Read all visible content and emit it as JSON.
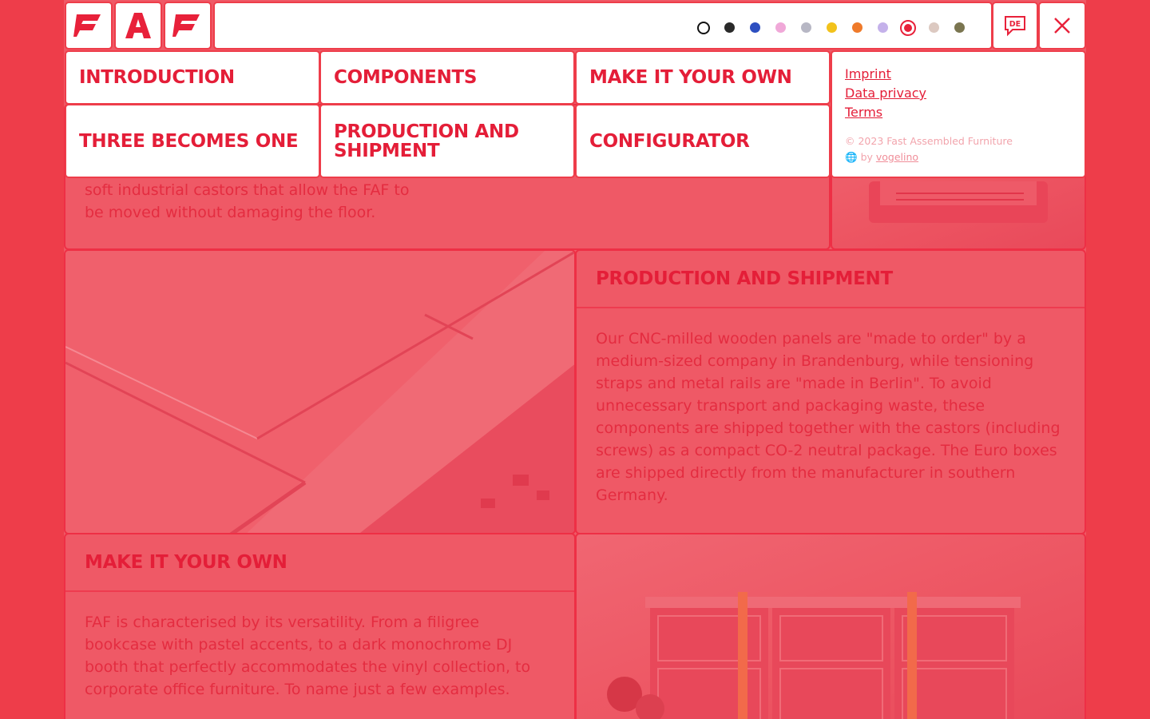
{
  "header": {
    "logo_letters": [
      "F",
      "A",
      "F"
    ],
    "swatches": [
      {
        "name": "white",
        "color": "#ffffff"
      },
      {
        "name": "black",
        "color": "#2a2a2a"
      },
      {
        "name": "blue",
        "color": "#2d4fc0"
      },
      {
        "name": "pink",
        "color": "#f0a8d8"
      },
      {
        "name": "grey",
        "color": "#b7b7c4"
      },
      {
        "name": "yellow",
        "color": "#f2c21b"
      },
      {
        "name": "orange",
        "color": "#ef7a2a"
      },
      {
        "name": "lavender",
        "color": "#c4b1ea"
      },
      {
        "name": "red",
        "color": "#e8213a"
      },
      {
        "name": "beige",
        "color": "#dcc9c1"
      },
      {
        "name": "olive",
        "color": "#7a7550"
      }
    ],
    "selected_swatch": "red",
    "language_label": "DE"
  },
  "menu": {
    "items": [
      {
        "label": "INTRODUCTION"
      },
      {
        "label": "COMPONENTS"
      },
      {
        "label": "MAKE IT YOUR OWN"
      },
      {
        "label": "THREE BECOMES ONE"
      },
      {
        "label": "PRODUCTION AND SHIPMENT"
      },
      {
        "label": "CONFIGURATOR"
      }
    ],
    "legal": {
      "imprint": "Imprint",
      "privacy": "Data privacy",
      "terms": "Terms",
      "copyright": "© 2023 Fast Assembled Furniture",
      "by_prefix": "by",
      "by_link": "vogelino"
    }
  },
  "content": {
    "castors_text": "soft industrial castors that allow the FAF to be moved without damaging the floor.",
    "production": {
      "title": "PRODUCTION AND SHIPMENT",
      "body": "Our CNC-milled wooden panels are \"made to order\" by a medium-sized company in Brandenburg, while tensioning straps and metal rails are \"made in Berlin\". To avoid unnecessary transport and packaging waste, these components are shipped together with the castors (including screws) as a compact CO-2 neutral package. The Euro boxes are shipped directly from the manufacturer in southern Germany."
    },
    "make_own": {
      "title": "MAKE IT YOUR OWN",
      "body": "FAF is characterised by its versatility. From a filigree bookcase with pastel accents, to a dark monochrome DJ booth that perfectly accommodates the vinyl collection, to corporate office furniture. To name just a few examples."
    }
  },
  "colors": {
    "brand_red": "#e8213a",
    "overlay": "#ef5966"
  }
}
